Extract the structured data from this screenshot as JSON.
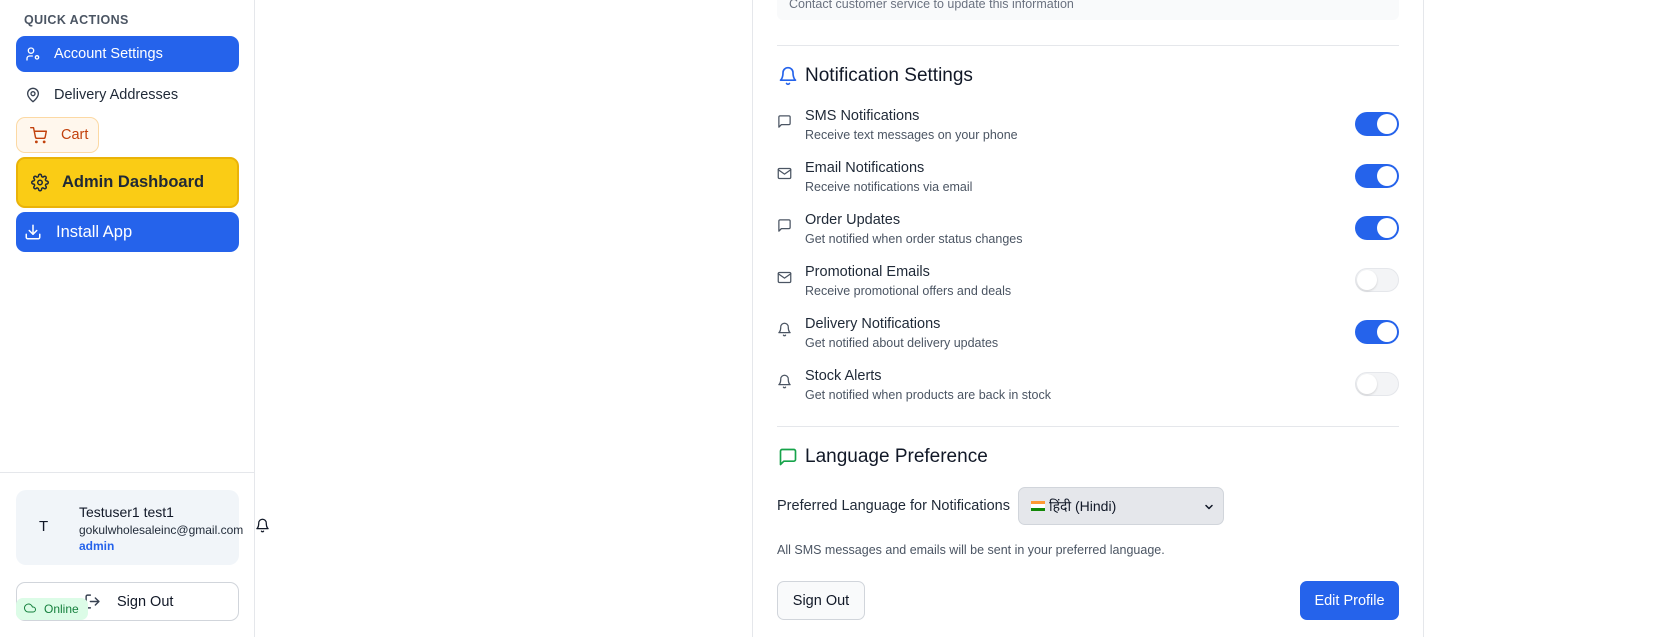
{
  "sidebar": {
    "quick_actions_title": "QUICK ACTIONS",
    "items": {
      "account": {
        "label": "Account Settings",
        "icon": "user-cog-icon"
      },
      "delivery": {
        "label": "Delivery Addresses",
        "icon": "map-pin-icon"
      },
      "cart": {
        "label": "Cart",
        "icon": "cart-icon"
      },
      "admin": {
        "label": "Admin Dashboard",
        "icon": "gear-icon"
      },
      "install": {
        "label": "Install App",
        "icon": "download-icon"
      }
    },
    "user": {
      "avatar_initial": "T",
      "name": "Testuser1 test1",
      "email": "gokulwholesaleinc@gmail.com",
      "role": "admin"
    },
    "sign_out_label": "Sign Out",
    "status": "Online"
  },
  "main": {
    "contact_note": "Contact customer service to update this information",
    "notifications": {
      "title": "Notification Settings",
      "items": [
        {
          "name": "SMS Notifications",
          "desc": "Receive text messages on your phone",
          "icon": "message-square-icon",
          "enabled": true
        },
        {
          "name": "Email Notifications",
          "desc": "Receive notifications via email",
          "icon": "mail-icon",
          "enabled": true
        },
        {
          "name": "Order Updates",
          "desc": "Get notified when order status changes",
          "icon": "message-square-icon",
          "enabled": true
        },
        {
          "name": "Promotional Emails",
          "desc": "Receive promotional offers and deals",
          "icon": "mail-icon",
          "enabled": false
        },
        {
          "name": "Delivery Notifications",
          "desc": "Get notified about delivery updates",
          "icon": "bell-icon",
          "enabled": true
        },
        {
          "name": "Stock Alerts",
          "desc": "Get notified when products are back in stock",
          "icon": "bell-icon",
          "enabled": false
        }
      ]
    },
    "language": {
      "title": "Language Preference",
      "label": "Preferred Language for Notifications",
      "selected": "हिंदी (Hindi)",
      "note": "All SMS messages and emails will be sent in your preferred language."
    },
    "buttons": {
      "sign_out": "Sign Out",
      "edit_profile": "Edit Profile"
    }
  },
  "colors": {
    "primary": "#2563eb",
    "admin_yellow": "#facc15",
    "cart_orange": "#c2410c",
    "online_green": "#15803d"
  }
}
